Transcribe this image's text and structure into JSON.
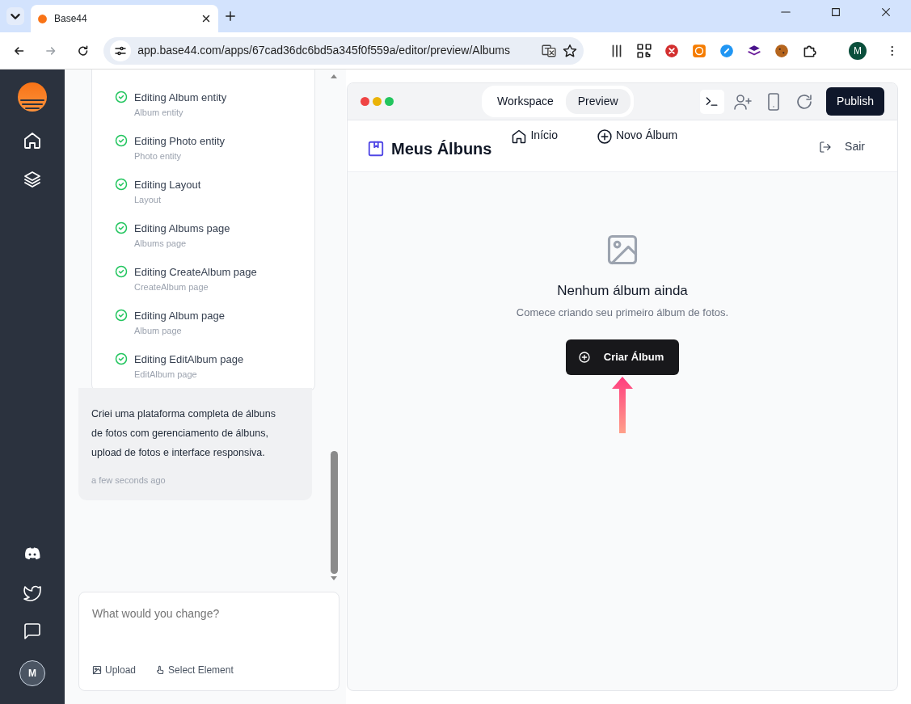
{
  "browser": {
    "tab_title": "Base44",
    "url": "app.base44.com/apps/67cad36dc6bd5a345f0f559a/editor/preview/Albums",
    "profile_initial": "M"
  },
  "sidebar": {
    "avatar_initial": "M"
  },
  "chat": {
    "steps": [
      {
        "title": "Editing Album entity",
        "subtitle": "Album entity",
        "done": true
      },
      {
        "title": "Editing Photo entity",
        "subtitle": "Photo entity",
        "done": true
      },
      {
        "title": "Editing Layout",
        "subtitle": "Layout",
        "done": true
      },
      {
        "title": "Editing Albums page",
        "subtitle": "Albums page",
        "done": true
      },
      {
        "title": "Editing CreateAlbum page",
        "subtitle": "CreateAlbum page",
        "done": true
      },
      {
        "title": "Editing Album page",
        "subtitle": "Album page",
        "done": true
      },
      {
        "title": "Editing EditAlbum page",
        "subtitle": "EditAlbum page",
        "done": true
      }
    ],
    "message": "Criei uma plataforma completa de álbuns de fotos com gerenciamento de álbuns, upload de fotos e interface responsiva.",
    "time": "a few seconds ago",
    "input": {
      "placeholder": "What would you change?"
    },
    "actions": [
      {
        "kind": "upload",
        "label": "Upload"
      },
      {
        "kind": "select",
        "label": "Select Element"
      }
    ]
  },
  "preview": {
    "modes": [
      {
        "label": "Workspace",
        "selected": false
      },
      {
        "label": "Preview",
        "selected": true
      }
    ],
    "publish": "Publish",
    "app": {
      "brand": "Meus Álbuns",
      "nav": [
        {
          "kind": "home",
          "label": "Início"
        },
        {
          "kind": "add",
          "label": "Novo Álbum"
        }
      ],
      "logout": "Sair",
      "empty_title": "Nenhum álbum ainda",
      "empty_text": "Comece criando seu primeiro álbum de fotos.",
      "create_button": "Criar Álbum"
    }
  }
}
